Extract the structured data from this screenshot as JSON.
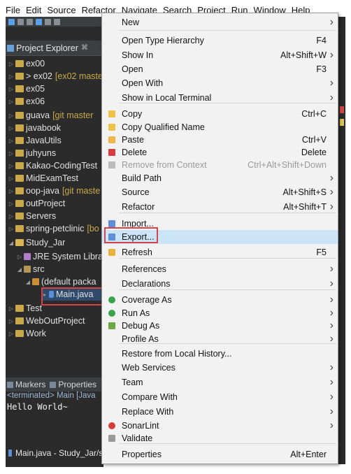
{
  "menubar": {
    "items": [
      "File",
      "Edit",
      "Source",
      "Refactor",
      "Navigate",
      "Search",
      "Project",
      "Run",
      "Window",
      "Help"
    ]
  },
  "explorer": {
    "title": "Project Explorer",
    "tab_marker": "⌘",
    "items": [
      {
        "label": "ex00",
        "extra": "",
        "level": 0,
        "expanded": false
      },
      {
        "label": "> ex02",
        "extra": "[ex02 maste",
        "level": 0,
        "expanded": false
      },
      {
        "label": "ex05",
        "extra": "",
        "level": 0,
        "expanded": false
      },
      {
        "label": "ex06",
        "extra": "",
        "level": 0,
        "expanded": false
      },
      {
        "label": "guava",
        "extra": "[git master",
        "level": 0,
        "expanded": false
      },
      {
        "label": "javabook",
        "extra": "",
        "level": 0,
        "expanded": false
      },
      {
        "label": "JavaUtils",
        "extra": "",
        "level": 0,
        "expanded": false
      },
      {
        "label": "juhyuns",
        "extra": "",
        "level": 0,
        "expanded": false
      },
      {
        "label": "Kakao-CodingTest",
        "extra": "",
        "level": 0,
        "expanded": false
      },
      {
        "label": "MidExamTest",
        "extra": "",
        "level": 0,
        "expanded": false
      },
      {
        "label": "oop-java",
        "extra": "[git maste",
        "level": 0,
        "expanded": false
      },
      {
        "label": "outProject",
        "extra": "",
        "level": 0,
        "expanded": false
      },
      {
        "label": "Servers",
        "extra": "",
        "level": 0,
        "expanded": false
      },
      {
        "label": "spring-petclinic",
        "extra": "[bo",
        "level": 0,
        "expanded": false
      },
      {
        "label": "Study_Jar",
        "extra": "",
        "level": 0,
        "expanded": true
      },
      {
        "label": "JRE System Libra",
        "extra": "",
        "level": 1,
        "expanded": false
      },
      {
        "label": "src",
        "extra": "",
        "level": 1,
        "expanded": true
      },
      {
        "label": "(default packa",
        "extra": "",
        "level": 2,
        "expanded": true
      },
      {
        "label": "Main.java",
        "extra": "",
        "level": 3,
        "expanded": false
      },
      {
        "label": "Test",
        "extra": "",
        "level": 0,
        "expanded": false
      },
      {
        "label": "WebOutProject",
        "extra": "",
        "level": 0,
        "expanded": false
      },
      {
        "label": "Work",
        "extra": "",
        "level": 0,
        "expanded": false
      }
    ]
  },
  "bottom": {
    "markers_tab": "Markers",
    "properties_tab": "Properties",
    "terminated": "<terminated> Main [Java",
    "console_output": "Hello World~"
  },
  "status": {
    "text": "Main.java - Study_Jar/s"
  },
  "context_menu": {
    "items": [
      {
        "label": "New",
        "accel": "",
        "submenu": true,
        "icon": ""
      },
      {
        "label": "Open Type Hierarchy",
        "accel": "F4",
        "submenu": false,
        "icon": ""
      },
      {
        "label": "Show In",
        "accel": "Alt+Shift+W",
        "submenu": true,
        "icon": ""
      },
      {
        "label": "Open",
        "accel": "F3",
        "submenu": false,
        "icon": ""
      },
      {
        "label": "Open With",
        "accel": "",
        "submenu": true,
        "icon": ""
      },
      {
        "label": "Show in Local Terminal",
        "accel": "",
        "submenu": true,
        "icon": ""
      },
      {
        "label": "Copy",
        "accel": "Ctrl+C",
        "submenu": false,
        "icon": "copy-icon"
      },
      {
        "label": "Copy Qualified Name",
        "accel": "",
        "submenu": false,
        "icon": "copy-qualified-icon"
      },
      {
        "label": "Paste",
        "accel": "Ctrl+V",
        "submenu": false,
        "icon": "paste-icon"
      },
      {
        "label": "Delete",
        "accel": "Delete",
        "submenu": false,
        "icon": "delete-icon"
      },
      {
        "label": "Remove from Context",
        "accel": "Ctrl+Alt+Shift+Down",
        "submenu": false,
        "icon": "remove-context-icon",
        "disabled": true
      },
      {
        "label": "Build Path",
        "accel": "",
        "submenu": true,
        "icon": ""
      },
      {
        "label": "Source",
        "accel": "Alt+Shift+S",
        "submenu": true,
        "icon": ""
      },
      {
        "label": "Refactor",
        "accel": "Alt+Shift+T",
        "submenu": true,
        "icon": ""
      },
      {
        "label": "Import...",
        "accel": "",
        "submenu": false,
        "icon": "import-icon"
      },
      {
        "label": "Export...",
        "accel": "",
        "submenu": false,
        "icon": "export-icon",
        "selected": true
      },
      {
        "label": "Refresh",
        "accel": "F5",
        "submenu": false,
        "icon": "refresh-icon"
      },
      {
        "label": "References",
        "accel": "",
        "submenu": true,
        "icon": ""
      },
      {
        "label": "Declarations",
        "accel": "",
        "submenu": true,
        "icon": ""
      },
      {
        "label": "Coverage As",
        "accel": "",
        "submenu": true,
        "icon": "coverage-icon"
      },
      {
        "label": "Run As",
        "accel": "",
        "submenu": true,
        "icon": "run-icon"
      },
      {
        "label": "Debug As",
        "accel": "",
        "submenu": true,
        "icon": "debug-icon"
      },
      {
        "label": "Profile As",
        "accel": "",
        "submenu": true,
        "icon": ""
      },
      {
        "label": "Restore from Local History...",
        "accel": "",
        "submenu": false,
        "icon": ""
      },
      {
        "label": "Web Services",
        "accel": "",
        "submenu": true,
        "icon": ""
      },
      {
        "label": "Team",
        "accel": "",
        "submenu": true,
        "icon": ""
      },
      {
        "label": "Compare With",
        "accel": "",
        "submenu": true,
        "icon": ""
      },
      {
        "label": "Replace With",
        "accel": "",
        "submenu": true,
        "icon": ""
      },
      {
        "label": "SonarLint",
        "accel": "",
        "submenu": true,
        "icon": "sonarlint-icon"
      },
      {
        "label": "Validate",
        "accel": "",
        "submenu": false,
        "icon": "validate-icon"
      },
      {
        "label": "Properties",
        "accel": "Alt+Enter",
        "submenu": false,
        "icon": ""
      }
    ]
  },
  "colors": {
    "menu_bg": "#f2f2f2",
    "selection": "#cce4f7",
    "highlight_box": "#d64545",
    "ide_bg": "#2b2b2b"
  }
}
